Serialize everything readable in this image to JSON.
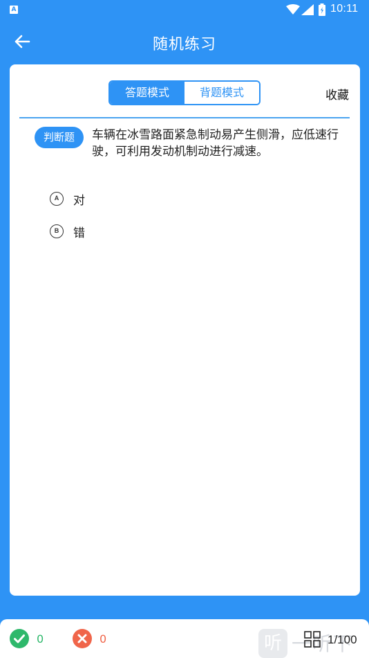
{
  "status_bar": {
    "app_badge": "A",
    "time": "10:11",
    "icons": [
      "wifi-icon",
      "signal-icon",
      "battery-icon"
    ]
  },
  "app_bar": {
    "title": "随机练习",
    "back_icon": "arrow-left-icon"
  },
  "mode_tabs": [
    {
      "label": "答题模式",
      "active": true
    },
    {
      "label": "背题模式",
      "active": false
    }
  ],
  "favorite_label": "收藏",
  "question": {
    "type_label": "判断题",
    "text": "车辆在冰雪路面紧急制动易产生侧滑，应低速行驶，可利用发动机制动进行减速。",
    "options": [
      {
        "letter": "A",
        "text": "对"
      },
      {
        "letter": "B",
        "text": "错"
      }
    ]
  },
  "bottom_bar": {
    "correct_count": "0",
    "wrong_count": "0",
    "progress": "1/100",
    "watermark_glyph": "听",
    "watermark_text": "一听下载"
  },
  "colors": {
    "primary": "#2e93f5",
    "correct": "#2eb86b",
    "wrong": "#f0654a"
  }
}
